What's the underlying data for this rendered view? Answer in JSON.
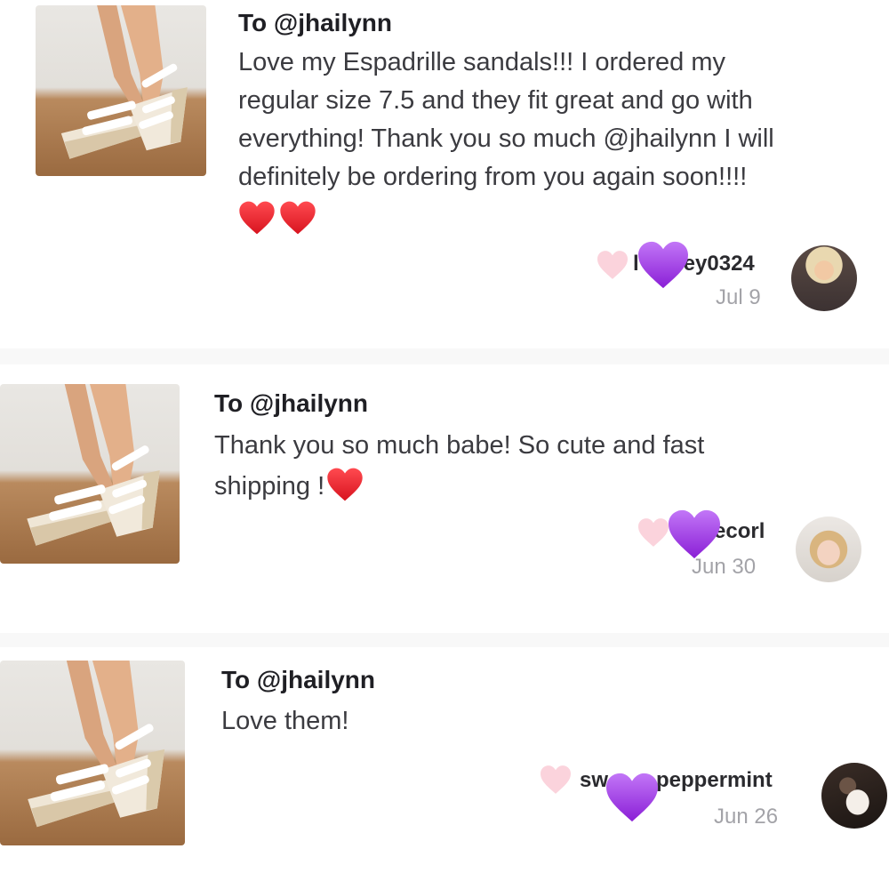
{
  "reviews": [
    {
      "to": "To @jhailynn",
      "message": "Love my Espadrille sandals!!! I ordered my regular size 7.5 and they fit great and go with everything! Thank you so much @jhailynn I will definitely be ordering from you again soon!!!!",
      "message_lines": [
        "Love my Espadrille sandals!!! I ordered my",
        "regular size 7.5 and they fit great and go with",
        "everything! Thank you so much @jhailynn I will",
        "definitely be ordering from you again soon!!!!"
      ],
      "emoji": [
        "red-heart",
        "red-heart"
      ],
      "username_visible": "ey0324",
      "username_prefix": "l",
      "date": "Jul 9"
    },
    {
      "to": "To @jhailynn",
      "message_lines": [
        "Thank you so much babe! So cute and fast",
        "shipping !"
      ],
      "emoji": [
        "red-heart"
      ],
      "username_visible": "ecorl",
      "date": "Jun 30"
    },
    {
      "to": "To @jhailynn",
      "message_lines": [
        "Love them!"
      ],
      "username_prefix": "sw",
      "username_visible": "peppermint",
      "date": "Jun 26"
    }
  ],
  "icons": {
    "like": "heart-outline-icon",
    "sticker": "purple-heart-emoji",
    "emoji": "red-heart-emoji"
  },
  "colors": {
    "like_heart": "#fbd3dc",
    "sticker_purple": "#a33ee8",
    "red_heart": "#e8212e",
    "date_gray": "#a3a3a8"
  }
}
